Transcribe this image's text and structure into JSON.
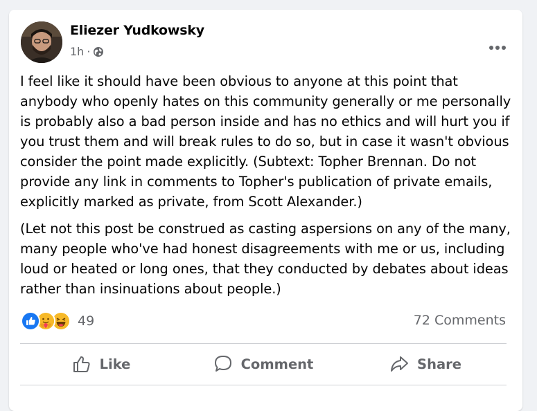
{
  "post": {
    "author": "Eliezer Yudkowsky",
    "time": "1h",
    "separator": "·",
    "privacy_icon": "globe-icon",
    "more_icon": "more-horizontal-icon",
    "paragraphs": [
      "I feel like it should have been obvious to anyone at this point that anybody who openly hates on this community generally or me personally is probably also a bad person inside and has no ethics and will hurt you if you trust them and will break rules to do so, but in case it wasn't obvious consider the point made explicitly.  (Subtext:  Topher Brennan.  Do not provide any link in comments to Topher's publication of private emails, explicitly marked as private, from Scott Alexander.)",
      "(Let not this post be construed as casting aspersions on any of the many, many people who've had honest disagreements with me or us, including loud or heated or long ones, that they conducted by debates about ideas rather than insinuations about people.)"
    ]
  },
  "reactions": {
    "icons": [
      "like-icon",
      "care-icon",
      "haha-icon"
    ],
    "count": "49",
    "comments": "72 Comments"
  },
  "actions": {
    "like": "Like",
    "comment": "Comment",
    "share": "Share"
  },
  "colors": {
    "background": "#f0f2f5",
    "card": "#ffffff",
    "text": "#050505",
    "secondary": "#65676b",
    "like_blue": "#1877f2",
    "emoji_yellow": "#f7b928"
  }
}
